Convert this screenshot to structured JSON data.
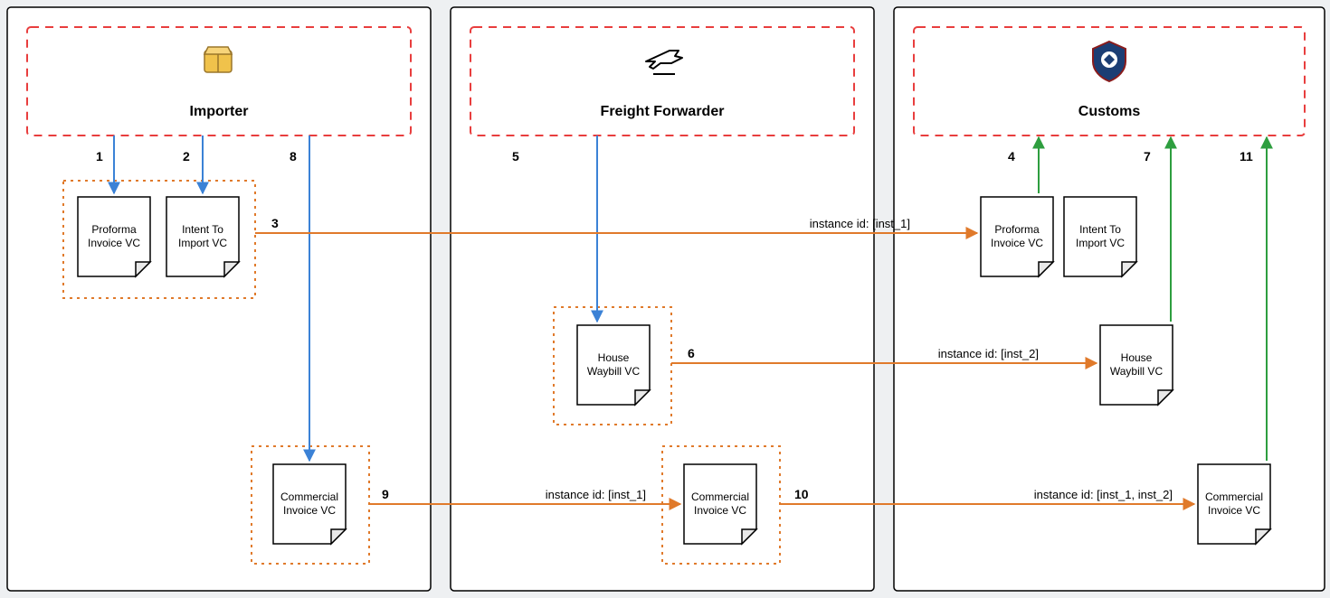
{
  "lanes": {
    "importer": {
      "label": "Importer"
    },
    "freight": {
      "label": "Freight Forwarder"
    },
    "customs": {
      "label": "Customs"
    }
  },
  "docs": {
    "proforma": {
      "line1": "Proforma",
      "line2": "Invoice VC"
    },
    "intent": {
      "line1": "Intent To",
      "line2": "Import VC"
    },
    "house": {
      "line1": "House",
      "line2": "Waybill VC"
    },
    "commercial": {
      "line1": "Commercial",
      "line2": "Invoice VC"
    }
  },
  "steps": {
    "s1": "1",
    "s2": "2",
    "s3": "3",
    "s4": "4",
    "s5": "5",
    "s6": "6",
    "s7": "7",
    "s8": "8",
    "s9": "9",
    "s10": "10",
    "s11": "11"
  },
  "edges": {
    "e3": "instance id: [inst_1]",
    "e6": "instance id: [inst_2]",
    "e9": "instance id: [inst_1]",
    "e10": "instance id: [inst_1, inst_2]"
  },
  "colors": {
    "laneBorder": "#000000",
    "actorDash": "#e83e3e",
    "dottedBox": "#e07a2b",
    "arrowBlue": "#3b82d6",
    "arrowOrange": "#e07a2b",
    "arrowGreen": "#2e9e3f",
    "bg": "#eef0f2"
  }
}
